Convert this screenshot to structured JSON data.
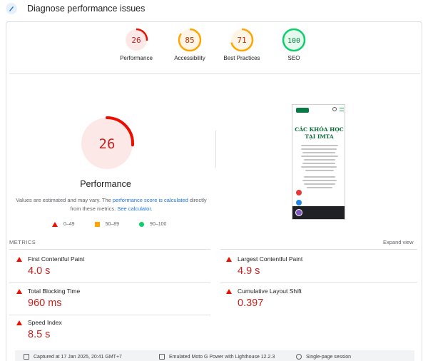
{
  "header": {
    "title": "Diagnose performance issues",
    "icon": "pagespeed-icon"
  },
  "summary": {
    "gauges": [
      {
        "key": "performance",
        "score": "26",
        "label": "Performance",
        "fraction": 0.26,
        "color": "#eb0f00",
        "bg": "#fde8e8",
        "text_color": "#c5221f"
      },
      {
        "key": "accessibility",
        "score": "85",
        "label": "Accessibility",
        "fraction": 0.85,
        "color": "#ffa400",
        "bg": "#fff5e6",
        "text_color": "#c33300"
      },
      {
        "key": "best-practices",
        "score": "71",
        "label": "Best Practices",
        "fraction": 0.71,
        "color": "#ffa400",
        "bg": "#fff5e6",
        "text_color": "#c33300"
      },
      {
        "key": "seo",
        "score": "100",
        "label": "SEO",
        "fraction": 1.0,
        "color": "#0cce6b",
        "bg": "#e6f9ee",
        "text_color": "#0d7f45"
      }
    ]
  },
  "main": {
    "score": "26",
    "fraction": 0.26,
    "title": "Performance",
    "note_1": "Values are estimated and may vary. The ",
    "note_link_1": "performance score is calculated",
    "note_2": " directly from these metrics. ",
    "note_link_2": "See calculator.",
    "legend": [
      {
        "shape": "triangle",
        "label": "0–49"
      },
      {
        "shape": "square",
        "label": "50–89"
      },
      {
        "shape": "circle",
        "label": "90–100"
      }
    ]
  },
  "screenshot": {
    "heading_line_1": "CÁC KHÓA HỌC",
    "heading_line_2": "TẠI IMTA"
  },
  "metrics": {
    "section_label": "METRICS",
    "expand_label": "Expand view",
    "items": [
      {
        "name": "First Contentful Paint",
        "value": "4.0 s"
      },
      {
        "name": "Largest Contentful Paint",
        "value": "4.9 s"
      },
      {
        "name": "Total Blocking Time",
        "value": "960 ms"
      },
      {
        "name": "Cumulative Layout Shift",
        "value": "0.397"
      },
      {
        "name": "Speed Index",
        "value": "8.5 s"
      }
    ]
  },
  "footer": {
    "captured": "Captured at 17 Jan 2025, 20:41 GMT+7",
    "device": "Emulated Moto G Power with Lighthouse 12.2.3",
    "session": "Single-page session"
  }
}
